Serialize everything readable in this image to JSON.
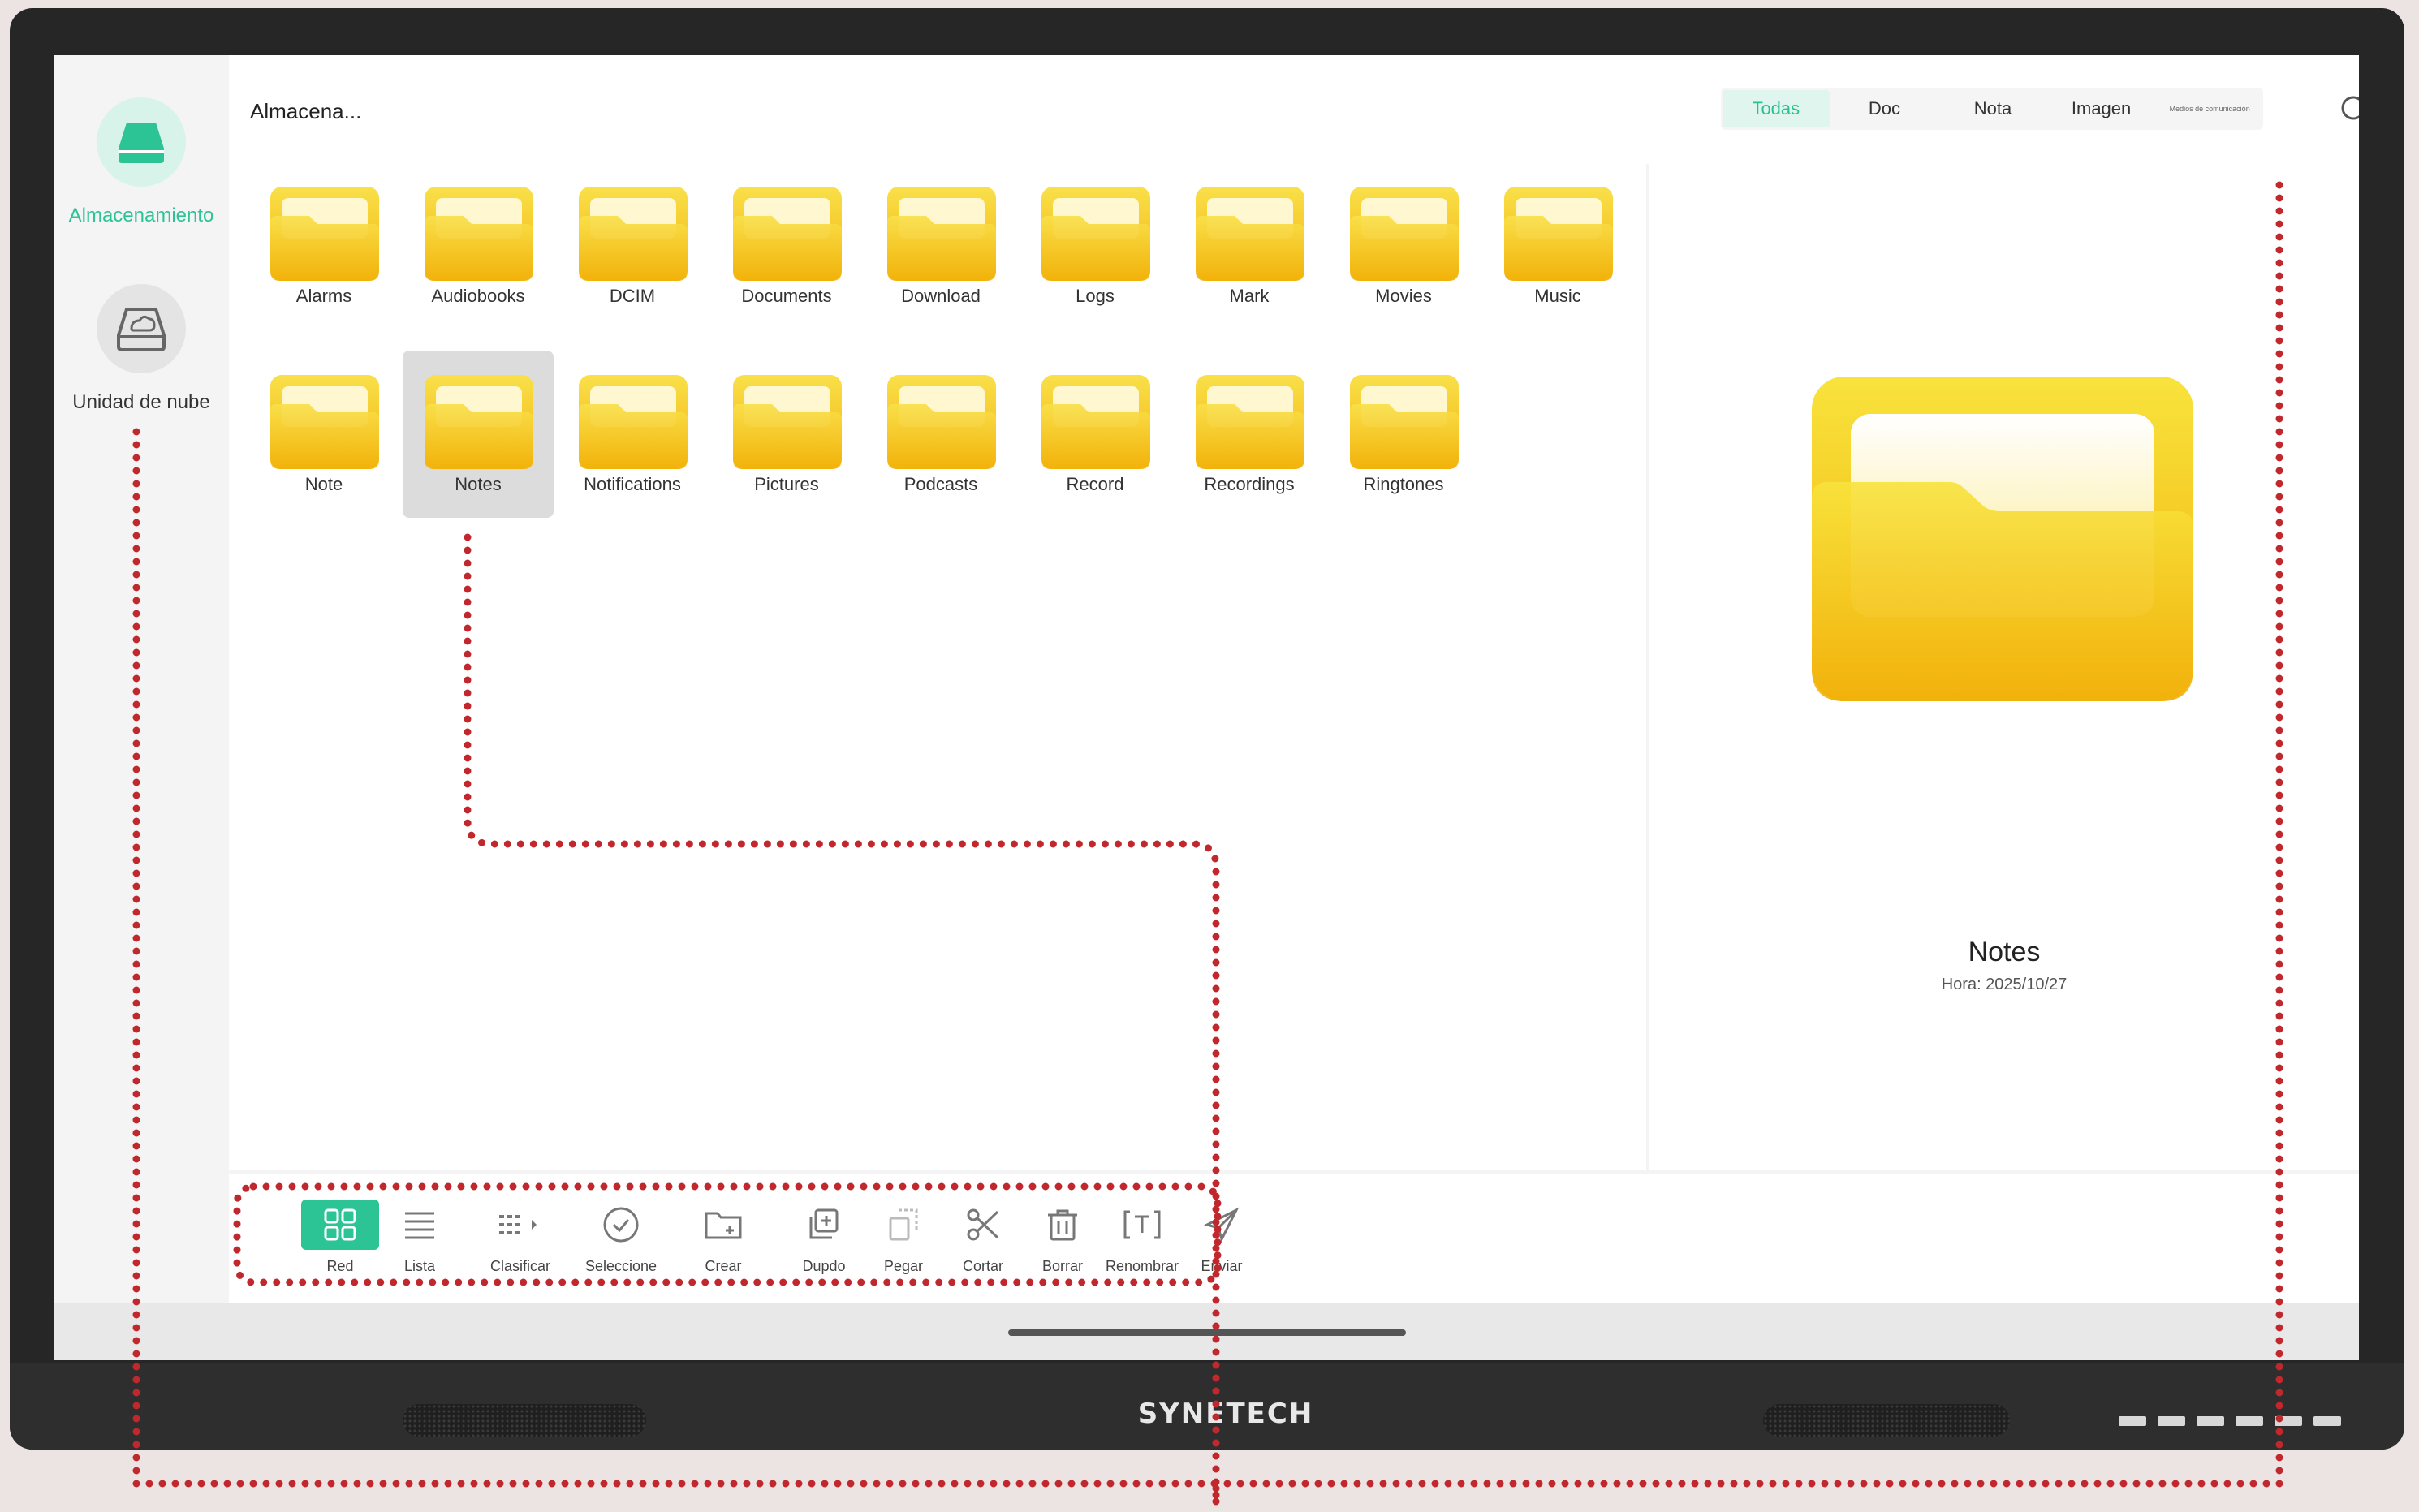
{
  "device": {
    "brand": "SYNETECH"
  },
  "sidebar": {
    "items": [
      {
        "label": "Almacenamiento",
        "icon": "drive-icon",
        "active": true
      },
      {
        "label": "Unidad de nube",
        "icon": "cloud-drive-icon",
        "active": false
      }
    ]
  },
  "header": {
    "title": "Almacena...",
    "tabs": [
      {
        "label": "Todas",
        "active": true
      },
      {
        "label": "Doc",
        "active": false
      },
      {
        "label": "Nota",
        "active": false
      },
      {
        "label": "Imagen",
        "active": false
      },
      {
        "label": "Medios de comunicación",
        "active": false
      }
    ],
    "search_icon": "search-icon"
  },
  "folders": [
    {
      "name": "Alarms"
    },
    {
      "name": "Audiobooks"
    },
    {
      "name": "DCIM"
    },
    {
      "name": "Documents"
    },
    {
      "name": "Download"
    },
    {
      "name": "Logs"
    },
    {
      "name": "Mark"
    },
    {
      "name": "Movies"
    },
    {
      "name": "Music"
    },
    {
      "name": "Note"
    },
    {
      "name": "Notes",
      "selected": true
    },
    {
      "name": "Notifications"
    },
    {
      "name": "Pictures"
    },
    {
      "name": "Podcasts"
    },
    {
      "name": "Record"
    },
    {
      "name": "Recordings"
    },
    {
      "name": "Ringtones"
    }
  ],
  "preview": {
    "name": "Notes",
    "time": "Hora: 2025/10/27"
  },
  "toolbar": {
    "items": [
      {
        "label": "Red",
        "icon": "grid-icon",
        "active": true
      },
      {
        "label": "Lista",
        "icon": "list-icon"
      },
      {
        "label": "Clasificar",
        "icon": "sort-icon"
      },
      {
        "label": "Seleccione",
        "icon": "select-check-icon"
      },
      {
        "label": "Crear",
        "icon": "new-folder-icon"
      },
      {
        "label": "Dupdo",
        "icon": "copy-icon"
      },
      {
        "label": "Pegar",
        "icon": "paste-icon"
      },
      {
        "label": "Cortar",
        "icon": "scissors-icon"
      },
      {
        "label": "Borrar",
        "icon": "trash-icon"
      },
      {
        "label": "Renombrar",
        "icon": "rename-icon"
      },
      {
        "label": "Enviar",
        "icon": "send-icon"
      }
    ]
  },
  "colors": {
    "accent": "#2cc495",
    "folder_top": "#f9e04a",
    "folder_bottom": "#f2b20a",
    "annotation": "#c0282d"
  }
}
